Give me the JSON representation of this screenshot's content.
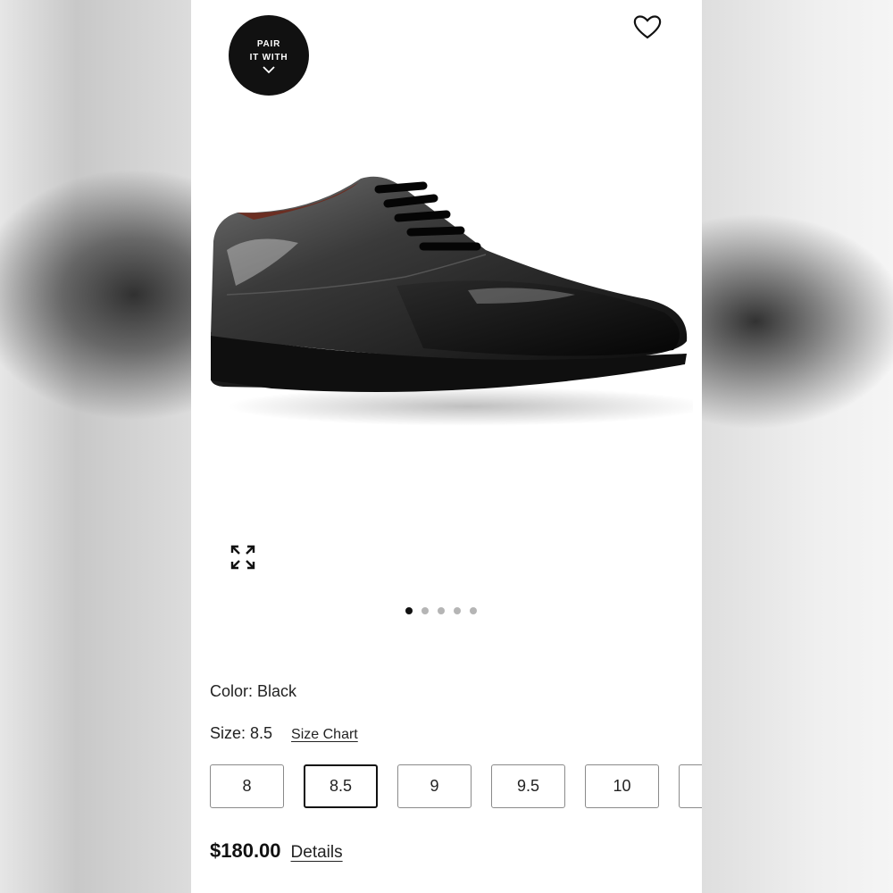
{
  "pair_badge": {
    "line1": "PAIR",
    "line2": "IT WITH",
    "icon": "chevron-down-icon"
  },
  "wishlist": {
    "icon": "heart-icon"
  },
  "gallery": {
    "image": "black-patent-oxford-shoe",
    "expand_icon": "expand-icon",
    "dot_count": 5,
    "active_dot": 1
  },
  "color": {
    "text": "Color: Black"
  },
  "size": {
    "text": "Size: 8.5",
    "chart_link": "Size Chart",
    "options": [
      "8",
      "8.5",
      "9",
      "9.5",
      "10",
      ""
    ],
    "selected": "8.5"
  },
  "price": {
    "amount": "$180.00",
    "details_link": "Details"
  },
  "colors": {
    "badge_bg": "#111111",
    "page_bg": "#ffffff",
    "border": "#8a8a8a",
    "selected_border": "#111111"
  }
}
